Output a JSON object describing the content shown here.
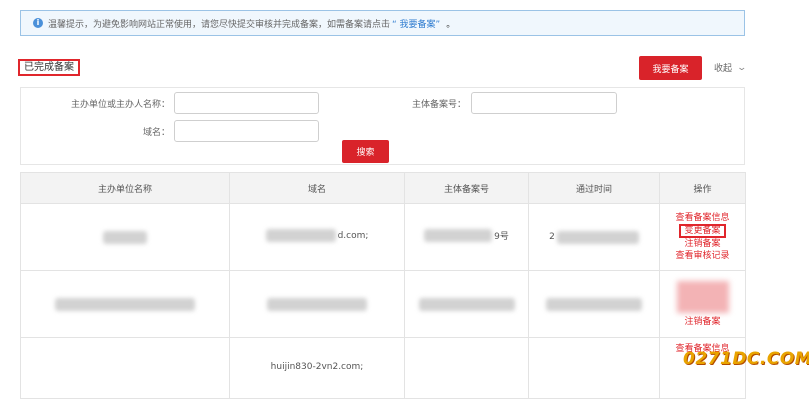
{
  "notice": {
    "text": "温馨提示，为避免影响网站正常使用，请您尽快提交审核并完成备案，如需备案请点击",
    "link": "“ 我要备案”",
    "tail": "。"
  },
  "section_title": "已完成备案",
  "apply_button": "我要备案",
  "collapse": {
    "label": "收起",
    "icon": "chevron-down-icon"
  },
  "search": {
    "owner_label": "主办单位或主办人名称：",
    "owner_value": "",
    "record_label": "主体备案号：",
    "record_value": "",
    "domain_label": "域名：",
    "domain_value": "",
    "button": "搜索"
  },
  "table": {
    "headers": [
      "主办单位名称",
      "域名",
      "主体备案号",
      "通过时间",
      "操作"
    ],
    "rows": [
      {
        "domain_suffix": "d.com;",
        "record_suffix": "9号",
        "time_prefix": "2",
        "actions": [
          "查看备案信息",
          "变更备案",
          "注销备案",
          "查看审核记录"
        ]
      },
      {
        "actions": [
          "注销备案"
        ]
      },
      {
        "domain": "huijin830-2vn2.com;",
        "actions": [
          "查看备案信息"
        ]
      }
    ]
  },
  "watermark": "0271DC.COM",
  "colors": {
    "accent": "#d9232a",
    "link": "#2f7cd0",
    "notice_border": "#9bc3e6"
  }
}
